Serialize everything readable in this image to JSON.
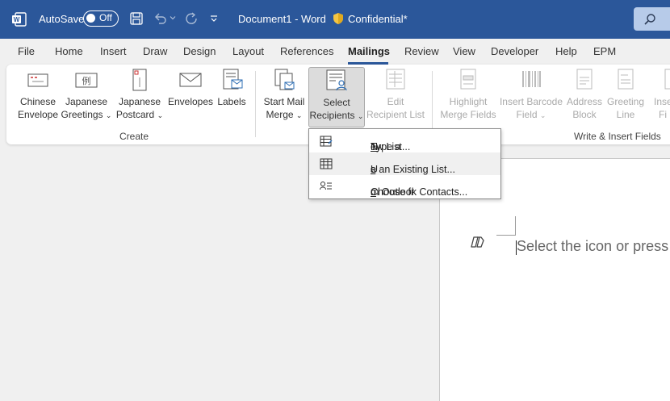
{
  "titlebar": {
    "autosave_label": "AutoSave",
    "autosave_state": "Off",
    "document_title": "Document1  -  Word",
    "sensitivity_label": "Confidential*"
  },
  "menu": {
    "items": [
      "File",
      "Home",
      "Insert",
      "Draw",
      "Design",
      "Layout",
      "References",
      "Mailings",
      "Review",
      "View",
      "Developer",
      "Help",
      "EPM"
    ],
    "active": "Mailings"
  },
  "ribbon": {
    "create": {
      "group_label": "Create",
      "chinese_envelope": [
        "Chinese",
        "Envelope"
      ],
      "japanese_greetings": [
        "Japanese",
        "Greetings"
      ],
      "japanese_postcard": [
        "Japanese",
        "Postcard"
      ],
      "envelopes": "Envelopes",
      "labels": "Labels"
    },
    "start_merge": {
      "start_mail_merge": [
        "Start Mail",
        "Merge"
      ],
      "select_recipients": [
        "Select",
        "Recipients"
      ],
      "edit_recipient_list": [
        "Edit",
        "Recipient List"
      ]
    },
    "write_insert": {
      "group_label": "Write & Insert Fields",
      "highlight_merge_fields": [
        "Highlight",
        "Merge Fields"
      ],
      "insert_barcode_field": [
        "Insert Barcode",
        "Field"
      ],
      "address_block": [
        "Address",
        "Block"
      ],
      "greeting_line": [
        "Greeting",
        "Line"
      ],
      "insert_merge_field": [
        "Inser",
        "Fi"
      ]
    }
  },
  "dropdown": {
    "type_new_list": {
      "before": "Type a ",
      "key": "N",
      "after": "ew List..."
    },
    "use_existing_list": {
      "before": "U",
      "key": "s",
      "after": "e an Existing List..."
    },
    "choose_outlook": {
      "before": "Choose fr",
      "key": "o",
      "after": "m Outlook Contacts..."
    }
  },
  "document": {
    "hint_text": "Select the icon or press"
  }
}
